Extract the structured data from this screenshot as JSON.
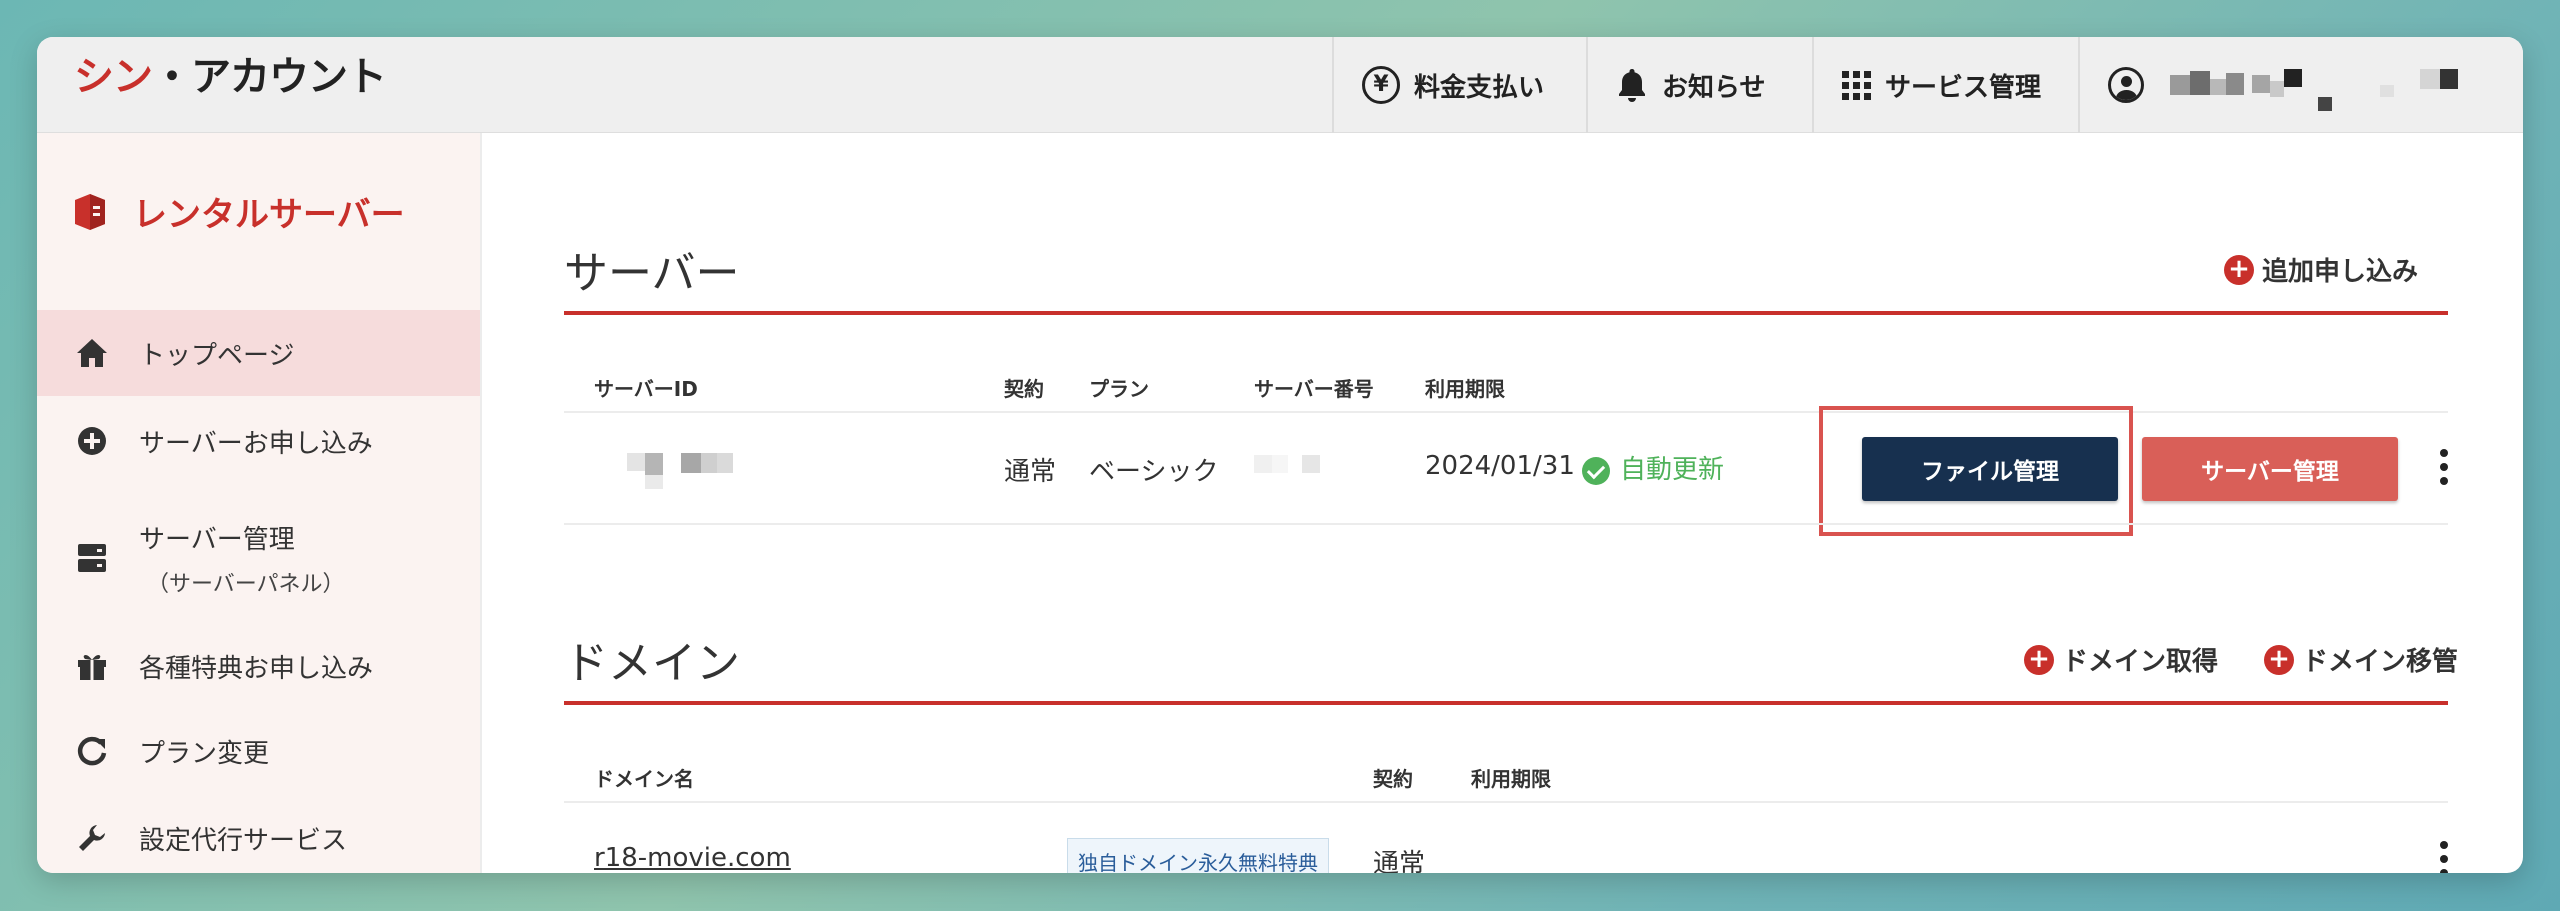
{
  "header": {
    "brand_accent": "シン",
    "brand_rest": "・アカウント",
    "nav": [
      {
        "label": "料金支払い",
        "icon": "yen-icon"
      },
      {
        "label": "お知らせ",
        "icon": "bell-icon"
      },
      {
        "label": "サービス管理",
        "icon": "grid-icon"
      },
      {
        "label": "",
        "icon": "user-icon"
      }
    ]
  },
  "sidebar": {
    "title": "レンタルサーバー",
    "items": [
      {
        "label": "トップページ",
        "icon": "home-icon",
        "active": true
      },
      {
        "label": "サーバーお申し込み",
        "icon": "plus-circle-icon"
      },
      {
        "label": "サーバー管理",
        "sub": "（サーバーパネル）",
        "icon": "server-icon"
      },
      {
        "label": "各種特典お申し込み",
        "icon": "gift-icon"
      },
      {
        "label": "プラン変更",
        "icon": "refresh-icon"
      },
      {
        "label": "設定代行サービス",
        "icon": "wrench-icon"
      }
    ]
  },
  "server_section": {
    "title": "サーバー",
    "action": "追加申し込み",
    "columns": [
      "サーバーID",
      "契約",
      "プラン",
      "サーバー番号",
      "利用期限"
    ],
    "row": {
      "contract": "通常",
      "plan": "ベーシック",
      "expiry": "2024/01/31",
      "auto_renew": "自動更新",
      "file_button": "ファイル管理",
      "server_button": "サーバー管理"
    }
  },
  "domain_section": {
    "title": "ドメイン",
    "actions": [
      "ドメイン取得",
      "ドメイン移管"
    ],
    "columns": [
      "ドメイン名",
      "契約",
      "利用期限"
    ],
    "row": {
      "domain": "r18-movie.com",
      "badge": "独自ドメイン永久無料特典",
      "contract": "通常"
    }
  },
  "colors": {
    "brand_red": "#c8302b",
    "navy_button": "#17304f",
    "salmon_button": "#d95f58",
    "renew_green": "#4fb25a"
  }
}
